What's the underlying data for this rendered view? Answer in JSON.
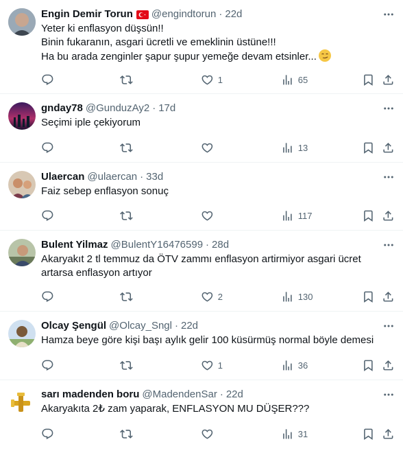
{
  "tweets": [
    {
      "name": "Engin Demir Torun",
      "handle": "@engindtorun",
      "time": "22d",
      "lines": [
        "Yeter ki enflasyon düşsün!!",
        "Binin fukaranın, asgari ücretli ve emeklinin üstüne!!!",
        "Ha bu arada zenginler şapur şupur yemeğe devam etsinler..."
      ],
      "likes": "1",
      "views": "65",
      "avatar_color": "#8a9aa8"
    },
    {
      "name": "gnday78",
      "handle": "@GunduzAy2",
      "time": "17d",
      "lines": [
        "Seçimi iple çekiyorum"
      ],
      "likes": "",
      "views": "13",
      "avatar_color": "#5b2a6e"
    },
    {
      "name": "Ulaercan",
      "handle": "@ulaercan",
      "time": "33d",
      "lines": [
        "Faiz sebep enflasyon sonuç"
      ],
      "likes": "",
      "views": "117",
      "avatar_color": "#c9a27a"
    },
    {
      "name": "Bulent Yilmaz",
      "handle": "@BulentY16476599",
      "time": "28d",
      "lines": [
        "Akaryakıt 2 tl temmuz da ÖTV zammı enflasyon artirmiyor asgari ücret",
        "artarsa enflasyon artıyor"
      ],
      "likes": "2",
      "views": "130",
      "avatar_color": "#7c8a6a"
    },
    {
      "name": "Olcay Şengül",
      "handle": "@Olcay_Sngl",
      "time": "22d",
      "lines": [
        "Hamza beye göre kişi başı aylık gelir 100 küsürmüş normal böyle demesi"
      ],
      "likes": "1",
      "views": "36",
      "avatar_color": "#6f8fb0"
    },
    {
      "name": "sarı madenden boru",
      "handle": "@MadendenSar",
      "time": "22d",
      "lines": [
        "Akaryakıta 2₺ zam yaparak, ENFLASYON MU DÜŞER???"
      ],
      "likes": "",
      "views": "31",
      "avatar_color": "#d9a520"
    }
  ],
  "colors": {
    "secondary_text": "#536471",
    "divider": "#eff3f4",
    "text": "#0f1419"
  },
  "icons": [
    "reply-icon",
    "retweet-icon",
    "heart-icon",
    "views-icon",
    "bookmark-icon",
    "share-icon",
    "more-icon",
    "turkey-flag-icon",
    "smirk-emoji-icon"
  ]
}
